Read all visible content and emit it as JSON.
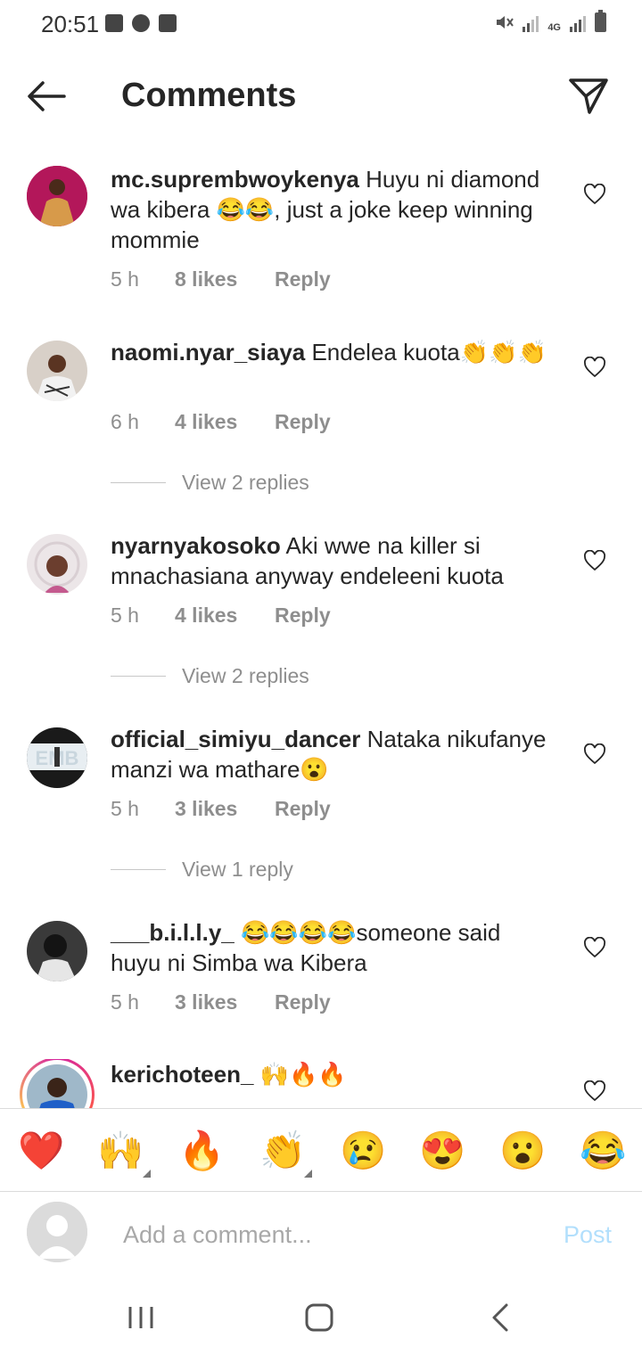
{
  "status_bar": {
    "time": "20:51",
    "network": "4G"
  },
  "header": {
    "title": "Comments"
  },
  "comments": [
    {
      "username": "mc.suprembwoykenya",
      "text": " Huyu ni diamond wa kibera 😂😂, just a joke keep winning mommie",
      "time": "5 h",
      "likes": "8 likes",
      "reply": "Reply"
    },
    {
      "username": "naomi.nyar_siaya",
      "text": " Endelea kuota👏👏👏",
      "time": "6 h",
      "likes": "4 likes",
      "reply": "Reply",
      "view_replies": "View 2 replies"
    },
    {
      "username": "nyarnyakosoko",
      "text": " Aki wwe na killer si mnachasiana anyway endeleeni kuota",
      "time": "5 h",
      "likes": "4 likes",
      "reply": "Reply",
      "view_replies": "View 2 replies"
    },
    {
      "username": "official_simiyu_dancer",
      "text": " Nataka nikufanye manzi wa mathare😮",
      "time": "5 h",
      "likes": "3 likes",
      "reply": "Reply",
      "view_replies": "View 1 reply"
    },
    {
      "username": "___b.i.l.l.y_",
      "text": " 😂😂😂😂someone said huyu ni Simba wa Kibera",
      "time": "5 h",
      "likes": "3 likes",
      "reply": "Reply"
    },
    {
      "username": "kerichoteen_",
      "text": " 🙌🔥🔥"
    }
  ],
  "emoji_bar": [
    "❤️",
    "🙌",
    "🔥",
    "👏",
    "😢",
    "😍",
    "😮",
    "😂"
  ],
  "composer": {
    "placeholder": "Add a comment...",
    "post_label": "Post"
  },
  "icons": {
    "back": "arrow-left-icon",
    "send": "paper-plane-icon",
    "like": "heart-outline-icon",
    "nav_recents": "recent-apps-icon",
    "nav_home": "home-icon",
    "nav_back": "nav-back-icon"
  },
  "colors": {
    "post_disabled": "#b2dffc",
    "secondary_text": "#8e8e8e",
    "primary_text": "#262626",
    "story_ring": "#d6249f"
  }
}
